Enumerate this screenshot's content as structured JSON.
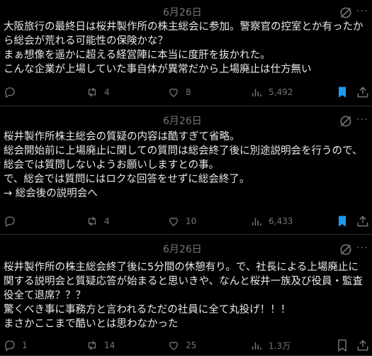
{
  "posts": [
    {
      "date": "6月26日",
      "text": "大阪旅行の最終日は桜井製作所の株主総会に参加。警察官の控室とか有ったから総会が荒れる可能性の保険かな？\nまぁ想像を遥かに超える経営陣に本当に度肝を抜かれた。\nこんな企業が上場していた事自体が異常だから上場廃止は仕方無い",
      "replies": "",
      "reposts": "4",
      "likes": "8",
      "views": "5,492"
    },
    {
      "date": "6月26日",
      "text": "桜井製作所株主総会の質疑の内容は酷すぎて省略。\n総会開始前に上場廃止に関しての質問は総会終了後に別途説明会を行うので、総会では質問しないようお願いしますとの事。\nで、総会では質問にはロクな回答をせずに総会終了。\n→ 総会後の説明会へ",
      "replies": "",
      "reposts": "4",
      "likes": "10",
      "views": "6,433"
    },
    {
      "date": "6月26日",
      "text": "桜井製作所の株主総会終了後に5分間の休憩有り。で、社長による上場廃止に関する説明会と質疑応答が始まると思いきや、なんと桜井一族及び役員・監査役全て退席？？？\n驚くべき事に事務方と言われるただの社員に全て丸投げ！！！\nまさかここまで酷いとは思わなかった",
      "replies": "1",
      "reposts": "14",
      "likes": "25",
      "views": "1.3万"
    }
  ],
  "colors": {
    "background": "#000000",
    "text": "#e7e9ea",
    "muted": "#71767b",
    "bookmark_active": "#1d9bf0",
    "divider": "#2f3336"
  },
  "icons": [
    "grok-icon",
    "more-icon",
    "reply-icon",
    "repost-icon",
    "like-icon",
    "views-icon",
    "bookmark-icon",
    "share-icon"
  ]
}
